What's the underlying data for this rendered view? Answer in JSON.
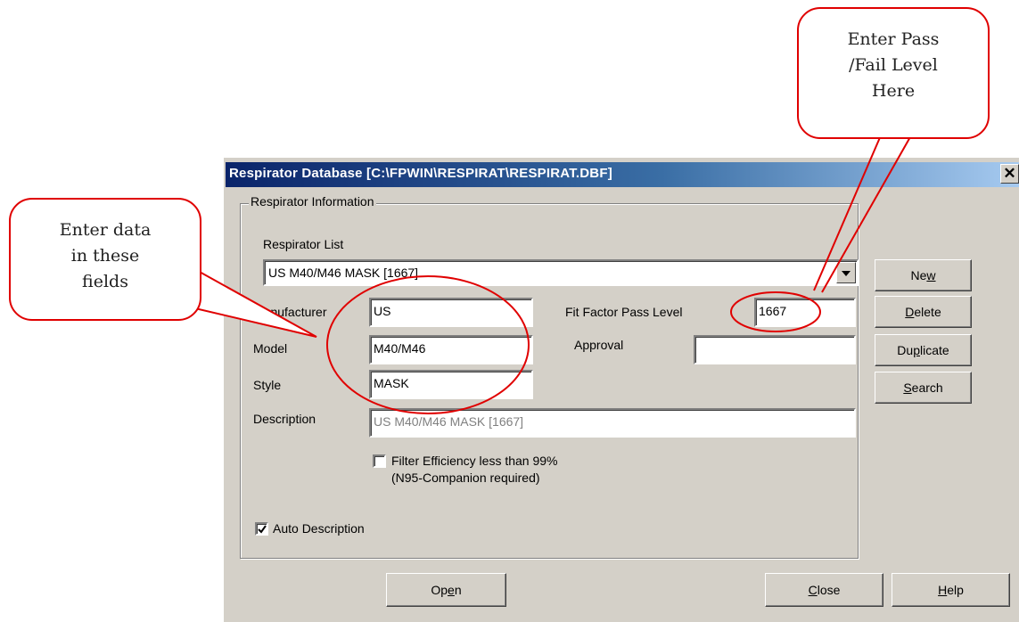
{
  "window": {
    "title": "Respirator Database [C:\\FPWIN\\RESPIRAT\\RESPIRAT.DBF]",
    "close_glyph": "✕"
  },
  "group": {
    "label": "Respirator Information"
  },
  "respirator_list": {
    "label": "Respirator List",
    "selected": "US M40/M46 MASK [1667]"
  },
  "fields": {
    "manufacturer": {
      "label": "Manufacturer",
      "value": "US"
    },
    "model": {
      "label": "Model",
      "value": "M40/M46"
    },
    "style": {
      "label": "Style",
      "value": "MASK"
    },
    "description": {
      "label": "Description",
      "value": "US M40/M46 MASK [1667]"
    },
    "fit_factor": {
      "label": "Fit Factor Pass Level",
      "value": "1667"
    },
    "approval": {
      "label": "Approval",
      "value": ""
    }
  },
  "checkboxes": {
    "filter_efficiency": {
      "line1": "Filter Efficiency less than 99%",
      "line2": "(N95-Companion required)",
      "checked": false
    },
    "auto_description": {
      "label": "Auto Description",
      "checked": true
    }
  },
  "buttons": {
    "new": {
      "pre": "Ne",
      "key": "w",
      "post": ""
    },
    "delete": {
      "pre": "",
      "key": "D",
      "post": "elete"
    },
    "duplicate": {
      "pre": "Du",
      "key": "p",
      "post": "licate"
    },
    "search": {
      "pre": "",
      "key": "S",
      "post": "earch"
    },
    "open": {
      "pre": "Op",
      "key": "e",
      "post": "n"
    },
    "close": {
      "pre": "",
      "key": "C",
      "post": "lose"
    },
    "help": {
      "pre": "",
      "key": "H",
      "post": "elp"
    }
  },
  "callouts": {
    "data_fields": {
      "line1": "Enter data",
      "line2": "in these",
      "line3": "fields"
    },
    "pass_level": {
      "line1": "Enter Pass",
      "line2": "/Fail Level",
      "line3": "Here"
    }
  },
  "colors": {
    "annotation_red": "#e00000",
    "titlebar_start": "#0a246a",
    "dialog_face": "#d4d0c8"
  }
}
